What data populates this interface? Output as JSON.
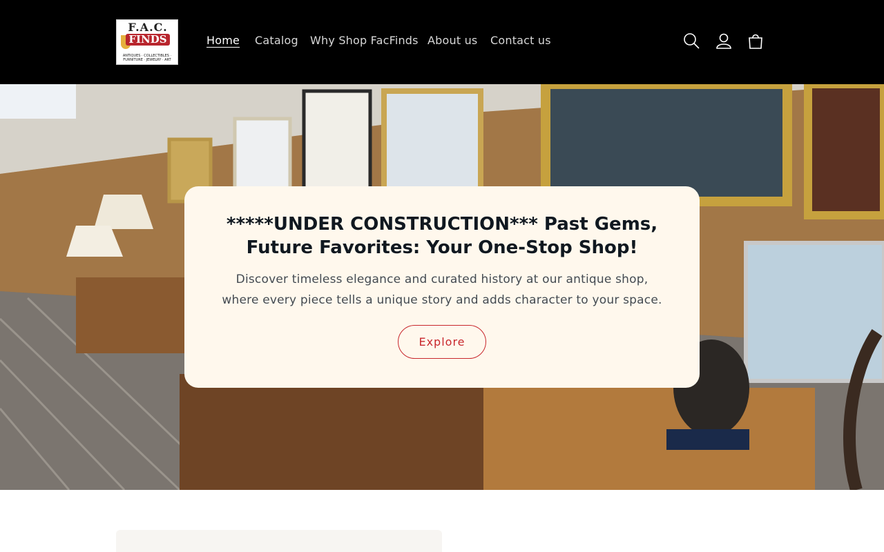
{
  "header": {
    "logo": {
      "line1": "F.A.C.",
      "line2": "FINDS",
      "tagline": "ANTIQUES · COLLECTIBLES · FURNITURE · JEWELRY · ART"
    },
    "nav": [
      {
        "label": "Home",
        "active": true
      },
      {
        "label": "Catalog",
        "active": false
      },
      {
        "label": "Why Shop FacFinds",
        "active": false
      },
      {
        "label": "About us",
        "active": false
      },
      {
        "label": "Contact us",
        "active": false
      }
    ],
    "icons": [
      "search-icon",
      "account-icon",
      "cart-icon"
    ]
  },
  "hero": {
    "title": "*****UNDER CONSTRUCTION*** Past Gems, Future Favorites: Your One-Stop Shop!",
    "description": "Discover timeless elegance and curated history at our antique shop, where every piece tells a unique story and adds character to your space.",
    "button_label": "Explore"
  },
  "colors": {
    "header_bg": "#000000",
    "card_bg": "#fff8ed",
    "accent": "#c8272c",
    "heading": "#101820"
  }
}
